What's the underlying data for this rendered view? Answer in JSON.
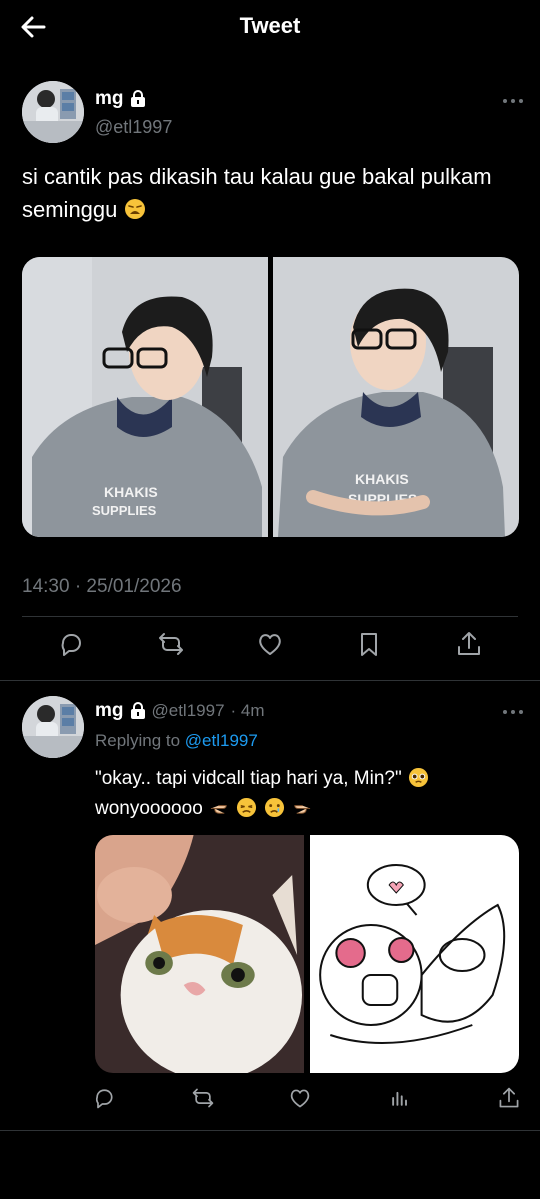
{
  "header": {
    "title": "Tweet"
  },
  "tweet": {
    "author_name": "mg",
    "author_handle": "@etl1997",
    "text": "si cantik pas dikasih tau kalau gue bakal pulkam seminggu",
    "timestamp": "14:30 · 25/01/2026",
    "images": [
      {
        "description_icon": "photo-person-left"
      },
      {
        "description_icon": "photo-person-right"
      }
    ]
  },
  "reply": {
    "author_name": "mg",
    "author_handle": "@etl1997",
    "time_ago": "· 4m",
    "replying_to_label": "Replying to",
    "replying_to_handle": "@etl1997",
    "text_line1": "\"okay.. tapi vidcall tiap hari ya, Min?\"",
    "text_line2": "wonyoooooo"
  },
  "colors": {
    "accent": "#1d9bf0",
    "muted": "#71767b",
    "background": "#000000",
    "text": "#e7e9ea"
  }
}
